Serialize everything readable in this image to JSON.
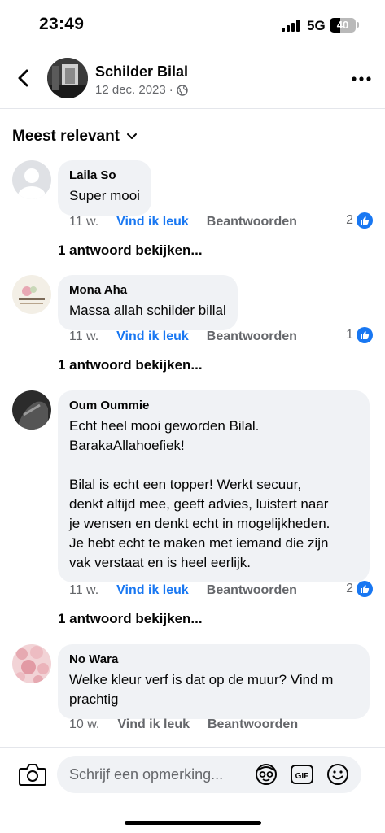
{
  "status_bar": {
    "time": "23:49",
    "network": "5G",
    "battery": "40",
    "battery_level": 0.4
  },
  "header": {
    "post_author": "Schilder Bilal",
    "date": "12 dec. 2023",
    "separator": "·",
    "icons": {
      "back": "back-chevron-icon",
      "privacy": "globe-icon",
      "more": "more-options-icon"
    }
  },
  "sort": {
    "label": "Meest relevant",
    "icon": "chevron-down-icon"
  },
  "comments": [
    {
      "author": "Laila So",
      "text": "Super mooi",
      "time": "11 w.",
      "like_label": "Vind ik leuk",
      "reply_label": "Beantwoorden",
      "reactions": "2",
      "view_replies": "1 antwoord bekijken..."
    },
    {
      "author": "Mona Aha",
      "text": "Massa allah schilder billal",
      "time": "11 w.",
      "like_label": "Vind ik leuk",
      "reply_label": "Beantwoorden",
      "reactions": "1",
      "view_replies": "1 antwoord bekijken..."
    },
    {
      "author": "Oum Oummie",
      "text": "Echt heel mooi geworden Bilal.\nBarakaAllahoefiek!\n\nBilal is echt een topper! Werkt secuur,\ndenkt altijd mee, geeft advies, luistert naar\nje wensen en denkt echt in mogelijkheden.\nJe hebt echt te maken met iemand die zijn\nvak verstaat en is heel eerlijk.",
      "time": "11 w.",
      "like_label": "Vind ik leuk",
      "reply_label": "Beantwoorden",
      "reactions": "2",
      "view_replies": "1 antwoord bekijken..."
    },
    {
      "author": "No Wara",
      "text": "Welke kleur verf is dat op de muur? Vind m\nprachtig",
      "time": "10 w.",
      "like_label": "Vind ik leuk",
      "reply_label": "Beantwoorden"
    }
  ],
  "composer": {
    "placeholder": "Schrijf een opmerking...",
    "icons": [
      "camera-icon",
      "avatar-sticker-icon",
      "gif-icon",
      "emoji-icon"
    ],
    "gif_label": "GIF"
  },
  "colors": {
    "accent": "#1877f2",
    "bubble": "#f0f2f5",
    "secondary_text": "#65676b"
  }
}
